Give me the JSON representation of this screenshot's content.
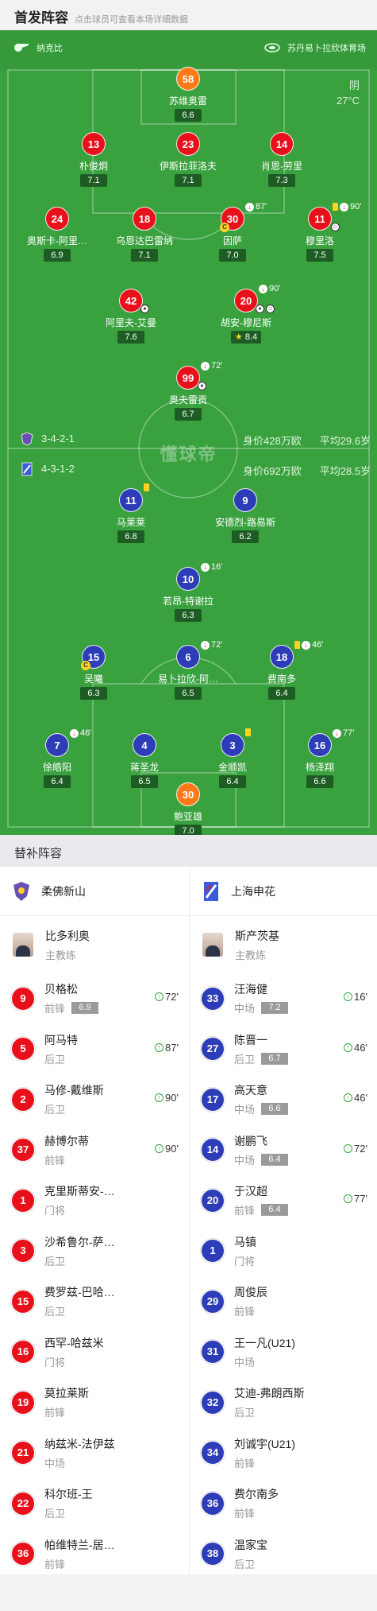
{
  "header": {
    "title": "首发阵容",
    "subtitle": "点击球员可查看本场详细数据"
  },
  "pitch": {
    "referee": "纳克比",
    "stadium": "苏丹易卜拉欣体育场",
    "weather": "阴",
    "temperature": "27°C",
    "watermark": "懂球帝",
    "home_team": {
      "formation": "3-4-2-1",
      "value": "身价428万欧",
      "avg_age": "平均29.6岁"
    },
    "away_team": {
      "formation": "4-3-1-2",
      "value": "身价692万欧",
      "avg_age": "平均28.5岁"
    }
  },
  "home_players": [
    {
      "num": "58",
      "name": "苏维奥雷",
      "rating": "6.6",
      "color": "orange"
    },
    {
      "num": "13",
      "name": "朴俊炯",
      "rating": "7.1",
      "color": "red"
    },
    {
      "num": "23",
      "name": "伊斯拉菲洛夫",
      "rating": "7.1",
      "color": "red"
    },
    {
      "num": "14",
      "name": "肖恩-劳里",
      "rating": "7.3",
      "color": "red"
    },
    {
      "num": "24",
      "name": "奥斯卡-阿里…",
      "rating": "6.9",
      "color": "red"
    },
    {
      "num": "18",
      "name": "乌恩达巴雷纳",
      "rating": "7.1",
      "color": "red"
    },
    {
      "num": "30",
      "name": "因萨",
      "rating": "7.0",
      "color": "red",
      "event": "87'"
    },
    {
      "num": "11",
      "name": "穆里洛",
      "rating": "7.5",
      "color": "red",
      "event": "90'"
    },
    {
      "num": "42",
      "name": "阿里夫-艾曼",
      "rating": "7.6",
      "color": "red"
    },
    {
      "num": "20",
      "name": "胡安-穆尼斯",
      "rating": "8.4",
      "color": "red",
      "event": "90'"
    },
    {
      "num": "99",
      "name": "奥夫雷贡",
      "rating": "6.7",
      "color": "red",
      "event": "72'"
    }
  ],
  "away_players": [
    {
      "num": "11",
      "name": "马莱莱",
      "rating": "6.8",
      "color": "blue"
    },
    {
      "num": "9",
      "name": "安德烈-路易斯",
      "rating": "6.2",
      "color": "blue"
    },
    {
      "num": "10",
      "name": "若昂-特谢拉",
      "rating": "6.3",
      "color": "blue",
      "event": "16'"
    },
    {
      "num": "15",
      "name": "吴曦",
      "rating": "6.3",
      "color": "blue"
    },
    {
      "num": "6",
      "name": "易卜拉欣-阿…",
      "rating": "6.5",
      "color": "blue",
      "event": "72'"
    },
    {
      "num": "18",
      "name": "费南多",
      "rating": "6.4",
      "color": "blue",
      "event": "46'"
    },
    {
      "num": "7",
      "name": "徐皓阳",
      "rating": "6.4",
      "color": "blue",
      "event": "46'"
    },
    {
      "num": "4",
      "name": "蒋圣龙",
      "rating": "6.5",
      "color": "blue"
    },
    {
      "num": "3",
      "name": "金顺凯",
      "rating": "6.4",
      "color": "blue"
    },
    {
      "num": "16",
      "name": "杨泽翔",
      "rating": "6.6",
      "color": "blue",
      "event": "77'"
    },
    {
      "num": "30",
      "name": "鲍亚雄",
      "rating": "7.0",
      "color": "orange"
    }
  ],
  "subs_title": "替补阵容",
  "home_subs": {
    "team": "柔佛新山",
    "coach": {
      "name": "比多利奥",
      "role": "主教练"
    },
    "players": [
      {
        "num": "9",
        "name": "贝格松",
        "pos": "前锋",
        "rating": "6.9",
        "time": "72'"
      },
      {
        "num": "5",
        "name": "阿马特",
        "pos": "后卫",
        "rating": "",
        "time": "87'"
      },
      {
        "num": "2",
        "name": "马修-戴维斯",
        "pos": "后卫",
        "rating": "",
        "time": "90'"
      },
      {
        "num": "37",
        "name": "赫博尔蒂",
        "pos": "前锋",
        "rating": "",
        "time": "90'"
      },
      {
        "num": "1",
        "name": "克里斯蒂安-…",
        "pos": "门将",
        "rating": "",
        "time": ""
      },
      {
        "num": "3",
        "name": "沙希鲁尔-萨…",
        "pos": "后卫",
        "rating": "",
        "time": ""
      },
      {
        "num": "15",
        "name": "费罗兹-巴哈…",
        "pos": "后卫",
        "rating": "",
        "time": ""
      },
      {
        "num": "16",
        "name": "西罕-哈兹米",
        "pos": "门将",
        "rating": "",
        "time": ""
      },
      {
        "num": "19",
        "name": "莫拉莱斯",
        "pos": "前锋",
        "rating": "",
        "time": ""
      },
      {
        "num": "21",
        "name": "纳兹米-法伊兹",
        "pos": "中场",
        "rating": "",
        "time": ""
      },
      {
        "num": "22",
        "name": "科尔班-王",
        "pos": "后卫",
        "rating": "",
        "time": ""
      },
      {
        "num": "36",
        "name": "帕维特兰-居…",
        "pos": "前锋",
        "rating": "",
        "time": ""
      }
    ]
  },
  "away_subs": {
    "team": "上海申花",
    "coach": {
      "name": "斯产茨基",
      "role": "主教练"
    },
    "players": [
      {
        "num": "33",
        "name": "汪海健",
        "pos": "中场",
        "rating": "7.2",
        "time": "16'"
      },
      {
        "num": "27",
        "name": "陈晋一",
        "pos": "后卫",
        "rating": "6.7",
        "time": "46'"
      },
      {
        "num": "17",
        "name": "高天意",
        "pos": "中场",
        "rating": "6.6",
        "time": "46'"
      },
      {
        "num": "14",
        "name": "谢鹏飞",
        "pos": "中场",
        "rating": "6.4",
        "time": "72'"
      },
      {
        "num": "20",
        "name": "于汉超",
        "pos": "前锋",
        "rating": "6.4",
        "time": "77'"
      },
      {
        "num": "1",
        "name": "马镇",
        "pos": "门将",
        "rating": "",
        "time": ""
      },
      {
        "num": "29",
        "name": "周俊辰",
        "pos": "前锋",
        "rating": "",
        "time": ""
      },
      {
        "num": "31",
        "name": "王一凡(U21)",
        "pos": "中场",
        "rating": "",
        "time": ""
      },
      {
        "num": "32",
        "name": "艾迪-弗朗西斯",
        "pos": "后卫",
        "rating": "",
        "time": ""
      },
      {
        "num": "34",
        "name": "刘诚宇(U21)",
        "pos": "前锋",
        "rating": "",
        "time": ""
      },
      {
        "num": "36",
        "name": "费尔南多",
        "pos": "前锋",
        "rating": "",
        "time": ""
      },
      {
        "num": "38",
        "name": "温家宝",
        "pos": "后卫",
        "rating": "",
        "time": ""
      }
    ]
  },
  "colors": {
    "pitch": "#3aa13f",
    "home": "#e8101b",
    "away": "#2d3db8",
    "keeper": "#ff7a16"
  }
}
